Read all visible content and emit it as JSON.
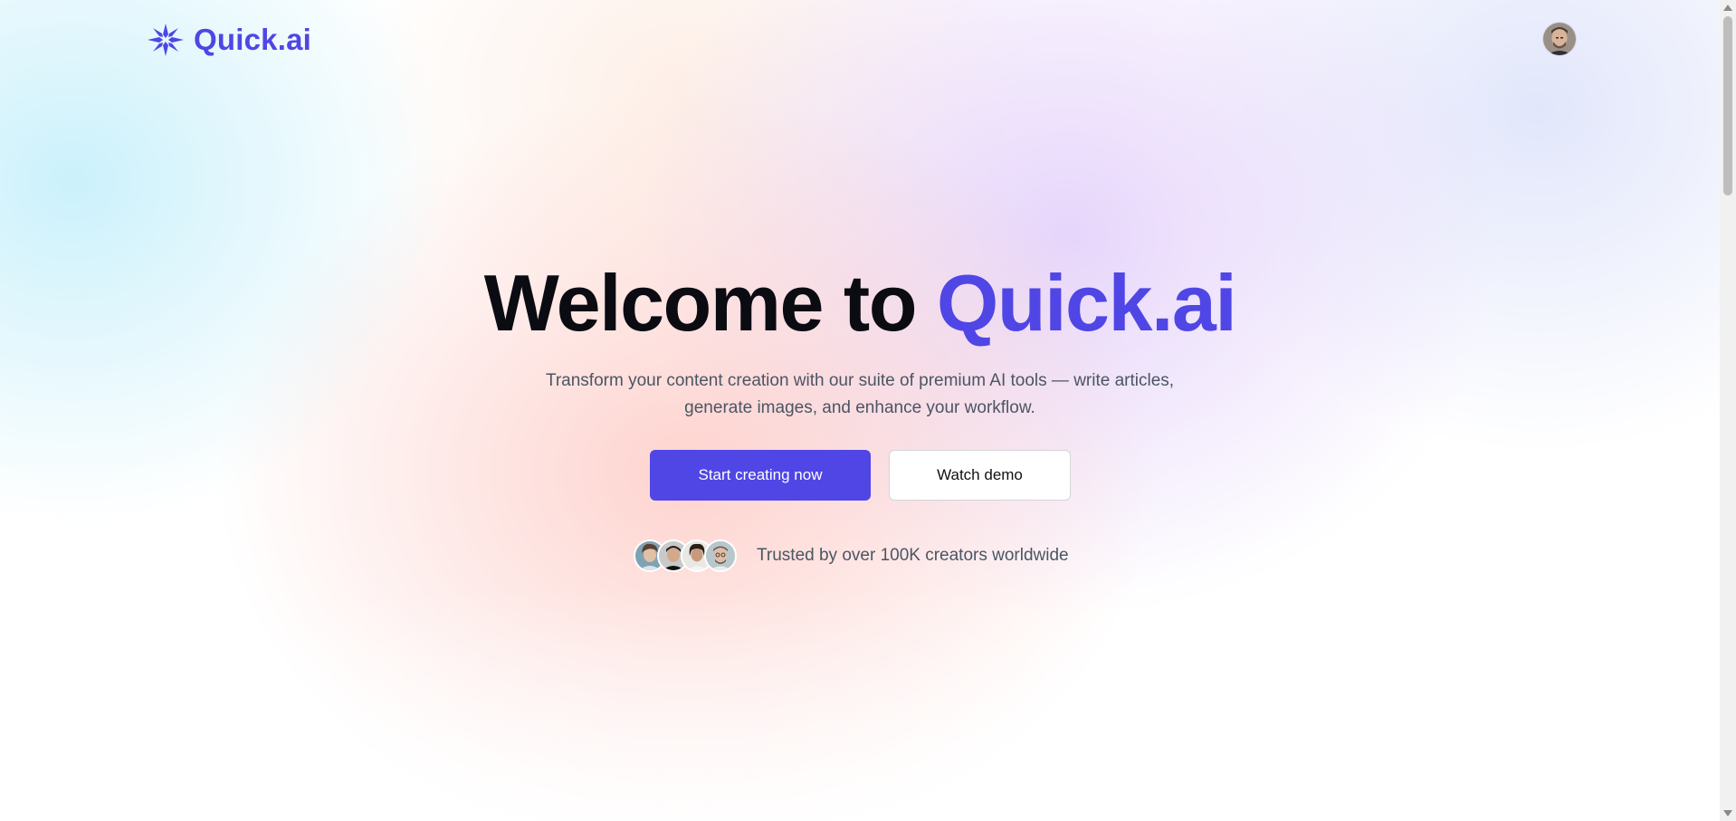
{
  "header": {
    "logo_text": "Quick.ai",
    "logo_icon": "sparkle-star-icon",
    "user_avatar": "user-avatar"
  },
  "hero": {
    "title_prefix": "Welcome to ",
    "title_accent": "Quick.ai",
    "subtitle": "Transform your content creation with our suite of premium AI tools — write articles, generate images, and enhance your workflow.",
    "primary_button": "Start creating now",
    "secondary_button": "Watch demo"
  },
  "social_proof": {
    "text": "Trusted by over 100K creators worldwide",
    "avatar_count": 4
  },
  "colors": {
    "accent": "#4f46e5",
    "title": "#0b0b12",
    "body_text": "#4b5563",
    "secondary_button_border": "#d4d4d8"
  }
}
